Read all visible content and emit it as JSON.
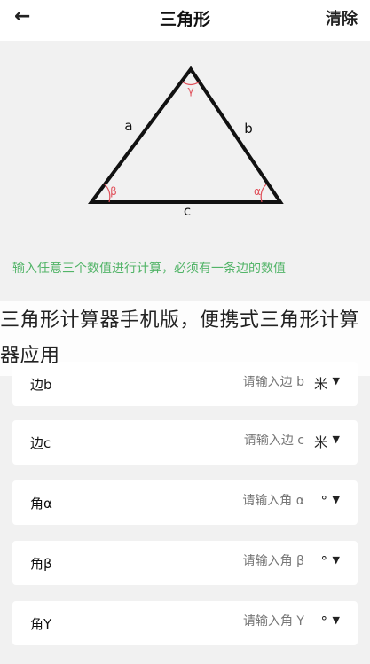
{
  "header": {
    "back_icon": "arrow-left-icon",
    "back_glyph": "←",
    "title": "三角形",
    "clear_label": "清除"
  },
  "triangle": {
    "sides": {
      "a": "a",
      "b": "b",
      "c": "c"
    },
    "angles": {
      "gamma": "γ",
      "beta": "β",
      "alpha": "α"
    },
    "angle_label_color": "#e0505a"
  },
  "hint": "输入任意三个数值进行计算，必须有一条边的数值",
  "accent_color": "#52b468",
  "fields": [
    {
      "label": "边b",
      "placeholder": "请输入边 b",
      "unit": "米"
    },
    {
      "label": "边c",
      "placeholder": "请输入边 c",
      "unit": "米"
    },
    {
      "label": "角α",
      "placeholder": "请输入角 α",
      "unit": "°"
    },
    {
      "label": "角β",
      "placeholder": "请输入角 β",
      "unit": "°"
    },
    {
      "label": "角Y",
      "placeholder": "请输入角 Y",
      "unit": "°"
    }
  ],
  "caret_glyph": "▼",
  "overlay_caption": "三角形计算器手机版，便携式三角形计算器应用"
}
